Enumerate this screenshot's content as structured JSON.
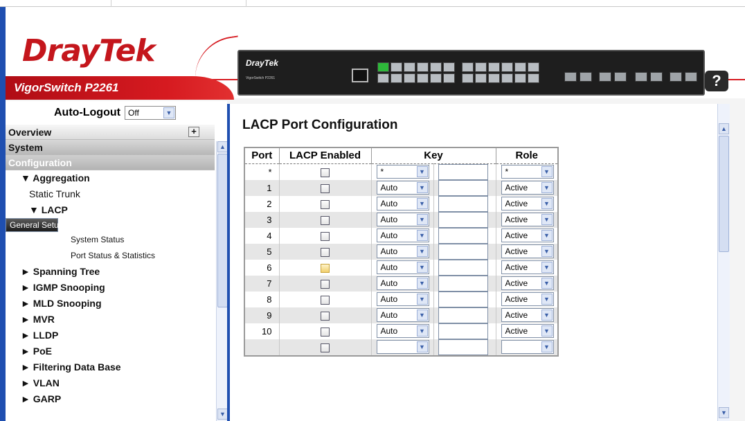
{
  "header": {
    "brand": "DrayTek",
    "model": "VigorSwitch P2261",
    "device_brand": "DrayTek",
    "device_sub": "VigorSwitch P2261",
    "help_label": "?"
  },
  "nav": {
    "autologout_label": "Auto-Logout",
    "autologout_value": "Off",
    "overview": "Overview",
    "system": "System",
    "configuration": "Configuration",
    "items": [
      {
        "label": "▼ Aggregation",
        "level": 1,
        "bold": true
      },
      {
        "label": "Static Trunk",
        "level": 2
      },
      {
        "label": "▼ LACP",
        "level": 2,
        "bold": true
      },
      {
        "label": "General Setup",
        "level": 3,
        "selected": true
      },
      {
        "label": "System Status",
        "level": 3
      },
      {
        "label": "Port Status & Statistics",
        "level": 3
      },
      {
        "label": "► Spanning Tree",
        "level": 1,
        "bold": true
      },
      {
        "label": "► IGMP Snooping",
        "level": 1,
        "bold": true
      },
      {
        "label": "► MLD Snooping",
        "level": 1,
        "bold": true
      },
      {
        "label": "► MVR",
        "level": 1,
        "bold": true
      },
      {
        "label": "► LLDP",
        "level": 1,
        "bold": true
      },
      {
        "label": "► PoE",
        "level": 1,
        "bold": true
      },
      {
        "label": "► Filtering Data Base",
        "level": 1,
        "bold": true
      },
      {
        "label": "► VLAN",
        "level": 1,
        "bold": true
      },
      {
        "label": "► GARP",
        "level": 1,
        "bold": true
      }
    ]
  },
  "main": {
    "title": "LACP Port Configuration",
    "columns": {
      "port": "Port",
      "lacp": "LACP Enabled",
      "key": "Key",
      "role": "Role"
    },
    "rows": [
      {
        "port": "*",
        "key": "*",
        "role": "*"
      },
      {
        "port": "1",
        "key": "Auto",
        "role": "Active"
      },
      {
        "port": "2",
        "key": "Auto",
        "role": "Active"
      },
      {
        "port": "3",
        "key": "Auto",
        "role": "Active"
      },
      {
        "port": "4",
        "key": "Auto",
        "role": "Active"
      },
      {
        "port": "5",
        "key": "Auto",
        "role": "Active"
      },
      {
        "port": "6",
        "key": "Auto",
        "role": "Active",
        "hover": true
      },
      {
        "port": "7",
        "key": "Auto",
        "role": "Active"
      },
      {
        "port": "8",
        "key": "Auto",
        "role": "Active"
      },
      {
        "port": "9",
        "key": "Auto",
        "role": "Active"
      },
      {
        "port": "10",
        "key": "Auto",
        "role": "Active"
      },
      {
        "port": "",
        "key": "",
        "role": ""
      }
    ]
  }
}
